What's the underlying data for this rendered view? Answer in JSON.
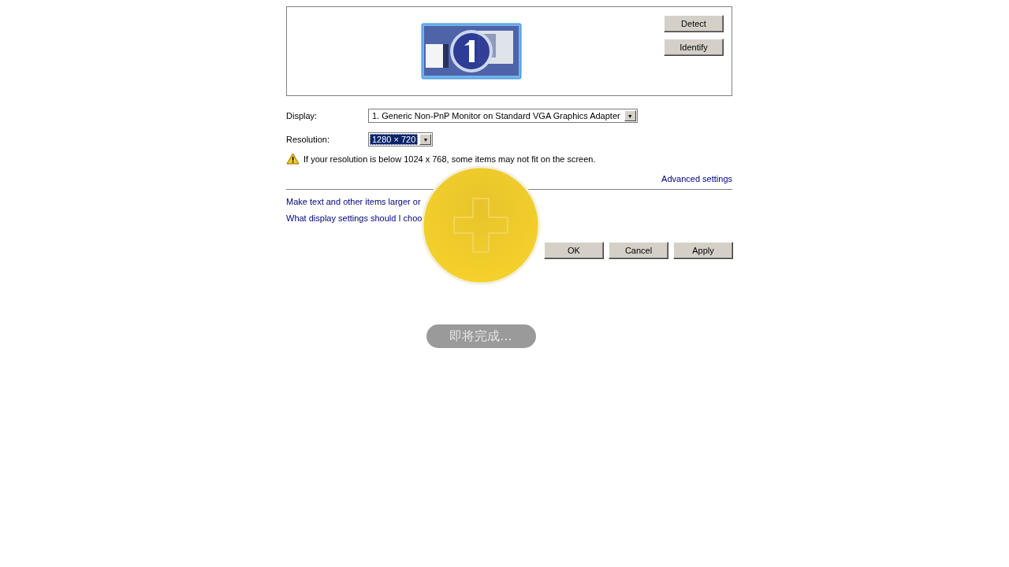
{
  "monitor_panel": {
    "buttons": [
      "Detect",
      "Identify"
    ]
  },
  "fields": [
    {
      "label": "Display:",
      "value": "1. Generic Non-PnP Monitor on Standard VGA Graphics Adapter",
      "focused": false,
      "caret": "▼"
    },
    {
      "label": "Resolution:",
      "value": "1280 × 720",
      "focused": true,
      "caret": "▼"
    }
  ],
  "warning": "If your resolution is below 1024 x 768, some items may not fit on the screen.",
  "advanced_link": "Advanced settings",
  "links": [
    "Make text and other items larger or",
    "What display settings should I choo"
  ],
  "buttons": [
    "OK",
    "Cancel",
    "Apply"
  ],
  "overlay": {
    "status": "即将完成..."
  }
}
